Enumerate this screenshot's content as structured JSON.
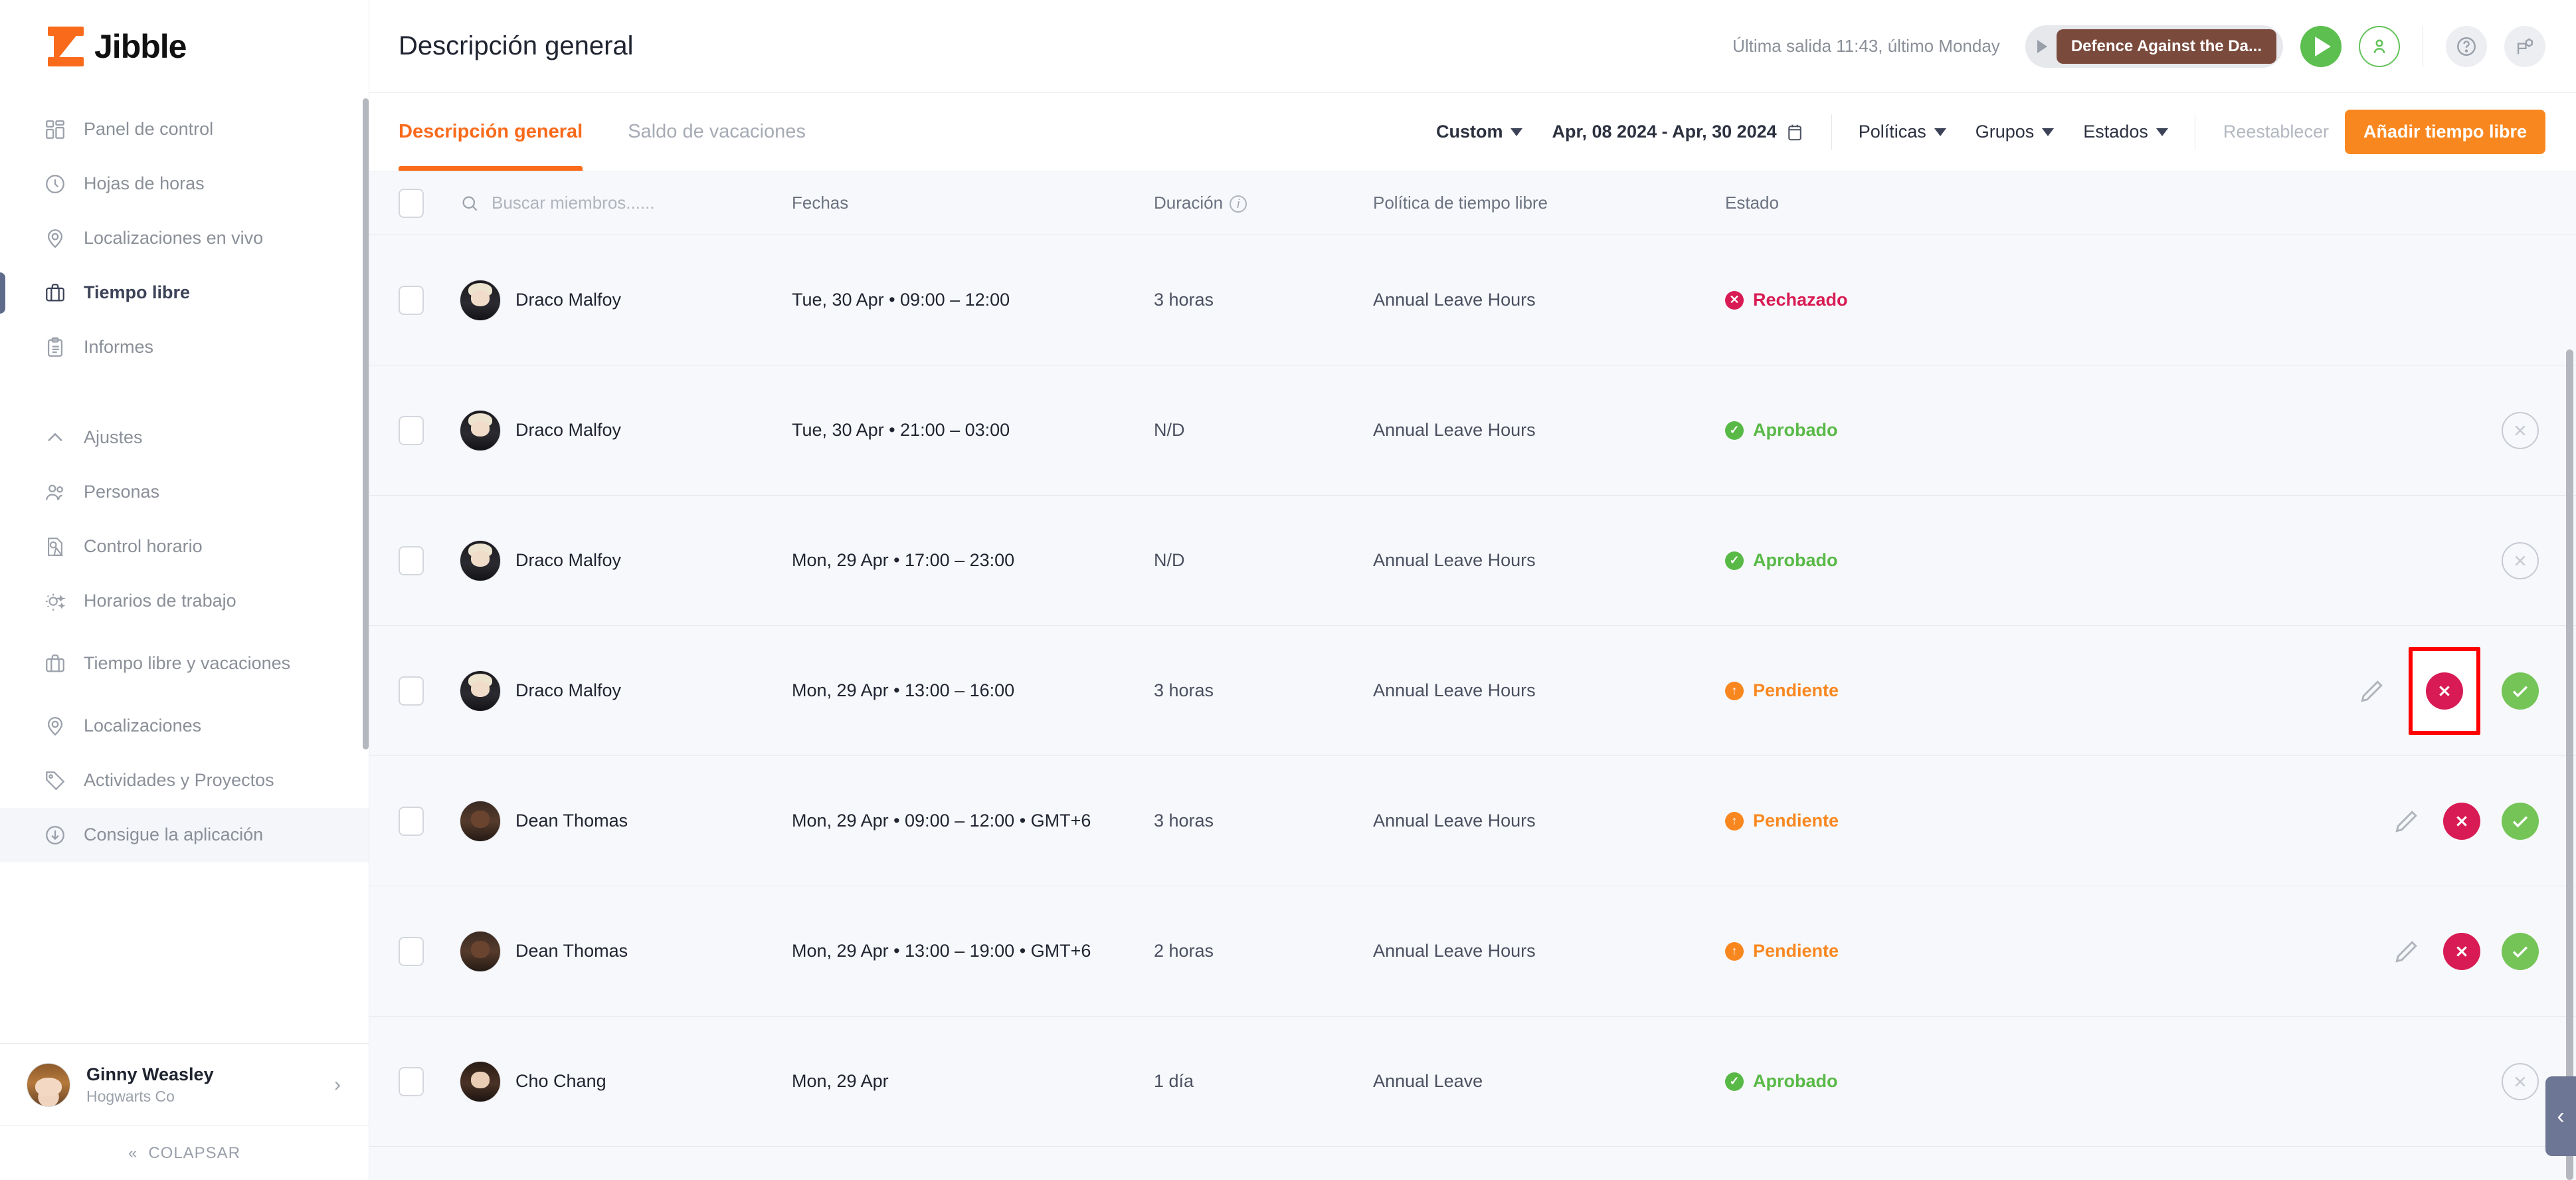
{
  "brand": {
    "name": "Jibble",
    "accent": "#f96a1b"
  },
  "sidebar": {
    "nav": [
      {
        "label": "Panel de control",
        "icon": "dashboard-icon",
        "active": false
      },
      {
        "label": "Hojas de horas",
        "icon": "clock-icon",
        "active": false
      },
      {
        "label": "Localizaciones en vivo",
        "icon": "location-pin-icon",
        "active": false
      },
      {
        "label": "Tiempo libre",
        "icon": "briefcase-icon",
        "active": true
      },
      {
        "label": "Informes",
        "icon": "clipboard-icon",
        "active": false
      }
    ],
    "settings": [
      {
        "label": "Ajustes",
        "icon": "chevron-up-icon"
      },
      {
        "label": "Personas",
        "icon": "people-icon"
      },
      {
        "label": "Control horario",
        "icon": "time-control-icon"
      },
      {
        "label": "Horarios de trabajo",
        "icon": "work-schedule-icon"
      },
      {
        "label": "Tiempo libre y vacaciones",
        "icon": "briefcase-icon"
      },
      {
        "label": "Localizaciones",
        "icon": "location-pin-icon"
      },
      {
        "label": "Actividades y Proyectos",
        "icon": "tag-icon"
      },
      {
        "label": "Consigue la aplicación",
        "icon": "download-icon"
      }
    ],
    "profile": {
      "name": "Ginny Weasley",
      "org": "Hogwarts Co",
      "chevron": "›"
    },
    "collapse_label": "COLAPSAR",
    "collapse_icon": "«"
  },
  "header": {
    "title": "Descripción general",
    "last_out": "Última salida 11:43, último Monday",
    "activity_chip": "Defence Against the Da...",
    "play_icon": "play-icon",
    "person_icon": "person-check-icon",
    "help_icon": "help-circle-icon",
    "settings_icon": "settings-flag-icon"
  },
  "toolbar": {
    "tabs": [
      {
        "label": "Descripción general",
        "active": true
      },
      {
        "label": "Saldo de vacaciones",
        "active": false
      }
    ],
    "period_label": "Custom",
    "date_range": "Apr, 08 2024 - Apr, 30 2024",
    "calendar_icon": "calendar-icon",
    "filters": [
      {
        "label": "Políticas"
      },
      {
        "label": "Grupos"
      },
      {
        "label": "Estados"
      }
    ],
    "reset_label": "Reestablecer",
    "add_label": "Añadir tiempo libre"
  },
  "table": {
    "search_placeholder": "Buscar miembros......",
    "search_value": "",
    "search_icon": "search-icon",
    "columns": {
      "dates": "Fechas",
      "duration": "Duración",
      "policy": "Política de tiempo libre",
      "status": "Estado"
    },
    "rows": [
      {
        "member": "Draco Malfoy",
        "avatar": "av-draco",
        "dates": "Tue, 30 Apr • 09:00 – 12:00",
        "duration": "3 horas",
        "policy": "Annual Leave Hours",
        "status": "Rechazado",
        "status_kind": "rejected",
        "actions": []
      },
      {
        "member": "Draco Malfoy",
        "avatar": "av-draco",
        "dates": "Tue, 30 Apr • 21:00 – 03:00",
        "duration": "N/D",
        "policy": "Annual Leave Hours",
        "status": "Aprobado",
        "status_kind": "approved",
        "actions": [
          "cancel"
        ]
      },
      {
        "member": "Draco Malfoy",
        "avatar": "av-draco",
        "dates": "Mon, 29 Apr • 17:00 – 23:00",
        "duration": "N/D",
        "policy": "Annual Leave Hours",
        "status": "Aprobado",
        "status_kind": "approved",
        "actions": [
          "cancel"
        ]
      },
      {
        "member": "Draco Malfoy",
        "avatar": "av-draco",
        "dates": "Mon, 29 Apr • 13:00 – 16:00",
        "duration": "3 horas",
        "policy": "Annual Leave Hours",
        "status": "Pendiente",
        "status_kind": "pending",
        "actions": [
          "edit",
          "reject",
          "approve"
        ],
        "highlighted_action": "reject"
      },
      {
        "member": "Dean Thomas",
        "avatar": "av-dean",
        "dates": "Mon, 29 Apr • 09:00 – 12:00 • GMT+6",
        "duration": "3 horas",
        "policy": "Annual Leave Hours",
        "status": "Pendiente",
        "status_kind": "pending",
        "actions": [
          "edit",
          "reject",
          "approve"
        ]
      },
      {
        "member": "Dean Thomas",
        "avatar": "av-dean",
        "dates": "Mon, 29 Apr • 13:00 – 19:00 • GMT+6",
        "duration": "2 horas",
        "policy": "Annual Leave Hours",
        "status": "Pendiente",
        "status_kind": "pending",
        "actions": [
          "edit",
          "reject",
          "approve"
        ]
      },
      {
        "member": "Cho Chang",
        "avatar": "av-cho",
        "dates": "Mon, 29 Apr",
        "duration": "1 día",
        "policy": "Annual Leave",
        "status": "Aprobado",
        "status_kind": "approved",
        "actions": [
          "cancel"
        ]
      }
    ]
  },
  "right_panel_toggle": "‹"
}
